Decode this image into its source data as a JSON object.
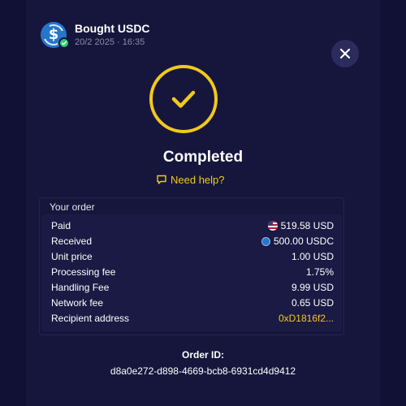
{
  "header": {
    "title": "Bought USDC",
    "subtitle": "20/2 2025 · 16:35",
    "coin_icon": "usdc-coin-icon",
    "badge_icon": "check-badge-icon",
    "close_icon": "close-icon"
  },
  "status": {
    "text": "Completed",
    "icon": "checkmark-icon",
    "color": "#f2c81d"
  },
  "help": {
    "label": "Need help?",
    "icon": "chat-bubble-icon"
  },
  "order": {
    "heading": "Your order",
    "rows": [
      {
        "label": "Paid",
        "value": "519.58 USD",
        "icon": "us-flag-icon"
      },
      {
        "label": "Received",
        "value": "500.00 USDC",
        "icon": "usdc-coin-icon"
      },
      {
        "label": "Unit price",
        "value": "1.00 USD"
      },
      {
        "label": "Processing fee",
        "value": "1.75%"
      },
      {
        "label": "Handling Fee",
        "value": "9.99 USD"
      },
      {
        "label": "Network fee",
        "value": "0.65 USD"
      },
      {
        "label": "Recipient address",
        "value": "0xD1816f2..."
      }
    ]
  },
  "order_id": {
    "label": "Order ID:",
    "value": "d8a0e272-d898-4669-bcb8-6931cd4d9412"
  },
  "colors": {
    "background": "#111135",
    "panel": "#16163d",
    "accent": "#f2c81d",
    "success": "#2ecc71",
    "usdc_blue": "#2775ca"
  }
}
